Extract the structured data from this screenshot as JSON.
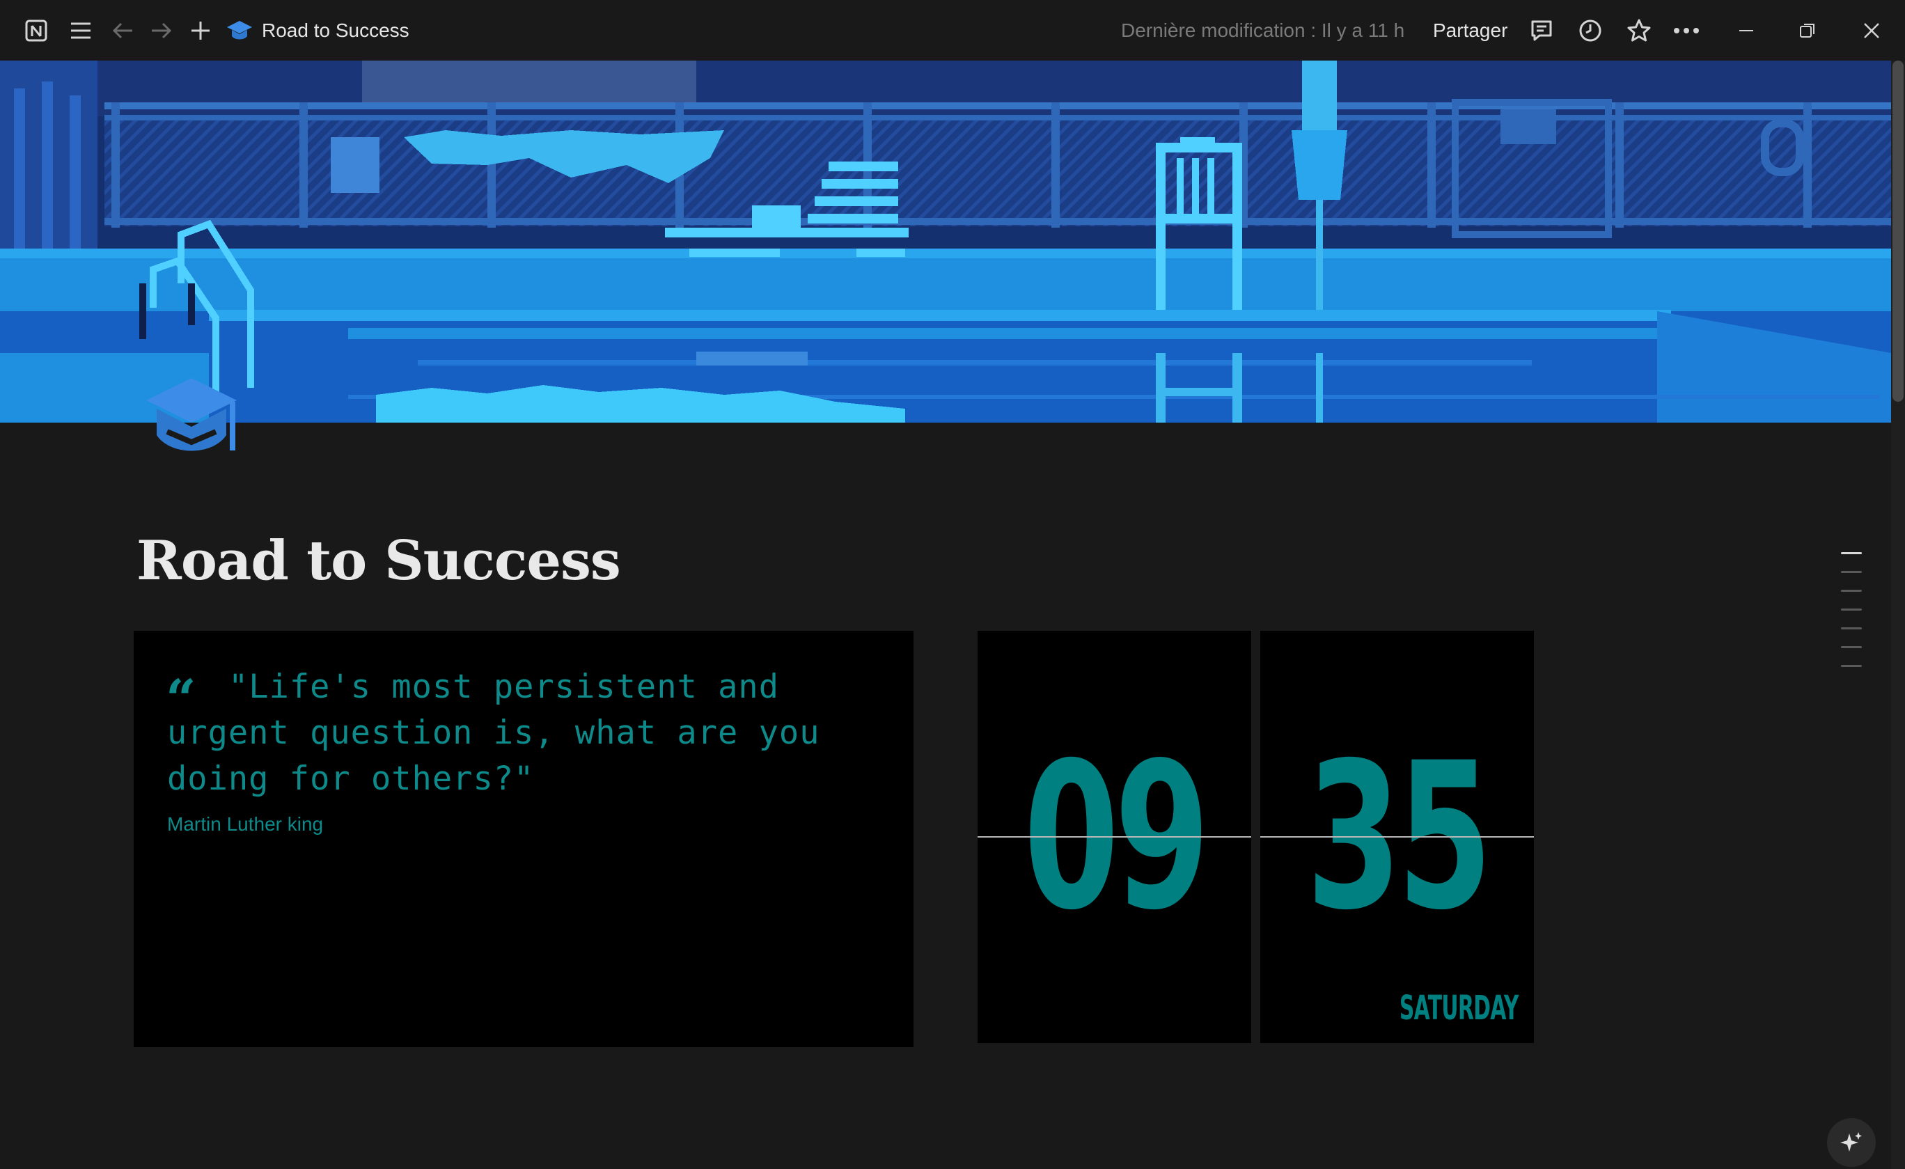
{
  "app": {
    "tab_title": "Road to Success"
  },
  "topbar": {
    "last_modified": "Dernière modification : Il y a 11 h",
    "share_label": "Partager"
  },
  "page": {
    "title": "Road to Success"
  },
  "quote_widget": {
    "text": "\"Life's most persistent and urgent question is, what are you doing for others?\"",
    "author": "Martin Luther king",
    "color": "#0e8a8a"
  },
  "clock_widget": {
    "hours": "09",
    "minutes": "35",
    "day": "SATURDAY",
    "color": "#008080"
  },
  "icons": {
    "notion": "notion-logo-icon",
    "menu": "hamburger-menu-icon",
    "back": "arrow-left-icon",
    "forward": "arrow-right-icon",
    "new": "plus-icon",
    "page": "graduation-cap-icon",
    "comments": "comment-icon",
    "history": "clock-icon",
    "favorite": "star-icon",
    "more": "more-horizontal-icon",
    "ai": "sparkle-icon"
  }
}
